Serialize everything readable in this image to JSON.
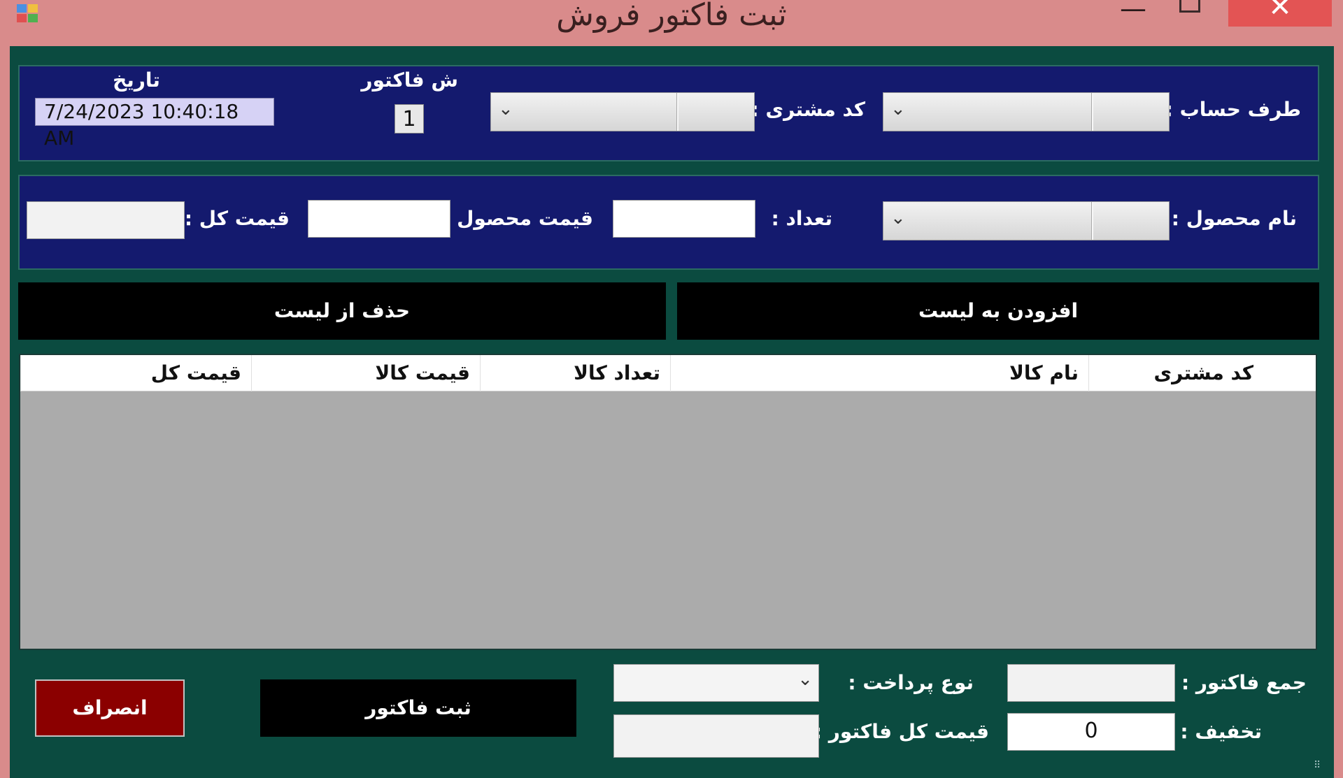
{
  "window": {
    "title": "ثبت فاکتور فروش",
    "minimize_glyph": "—",
    "close_glyph": "✕"
  },
  "header": {
    "account_label": "طرف حساب :",
    "account_value": "",
    "customer_code_label": "کد مشتری :",
    "customer_code_value": "",
    "invoice_no_label": "ش فاکتور",
    "invoice_no": "1",
    "date_label": "تاریخ",
    "date_value": "7/24/2023 10:40:18 AM"
  },
  "product": {
    "name_label": "نام محصول :",
    "name_value": "",
    "qty_label": "تعداد :",
    "qty_value": "",
    "price_label": "قیمت محصول :",
    "price_value": "",
    "total_label": "قیمت کل :",
    "total_value": ""
  },
  "actions": {
    "add_label": "افزودن به لیست",
    "remove_label": "حذف از لیست"
  },
  "grid": {
    "columns": [
      "کد مشتری",
      "نام کالا",
      "تعداد کالا",
      "قیمت کالا",
      "قیمت کل"
    ],
    "rows": []
  },
  "footer": {
    "invoice_sum_label": "جمع فاکتور :",
    "invoice_sum_value": "",
    "discount_label": "تخفیف :",
    "discount_value": "0",
    "payment_type_label": "نوع پرداخت :",
    "payment_type_value": "",
    "invoice_total_label": "قیمت کل فاکتور :",
    "invoice_total_value": "",
    "submit_label": "ثبت فاکتور",
    "cancel_label": "انصراف"
  },
  "colors": {
    "title_bar": "#d98b8b",
    "client_bg": "#0b4b40",
    "panel_bg": "#141a6e",
    "cancel_bg": "#8b0000",
    "grid_bg": "#ababab"
  }
}
